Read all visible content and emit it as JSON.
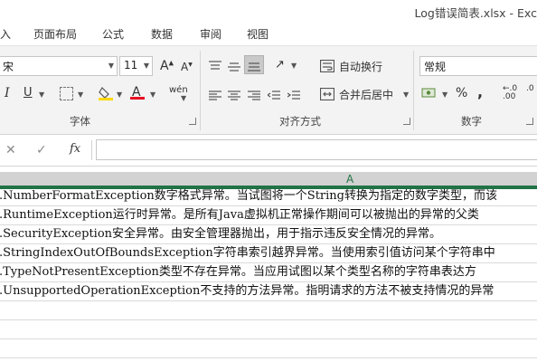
{
  "window": {
    "title": "Log错误简表.xlsx - Exc"
  },
  "tabs": [
    "入",
    "页面布局",
    "公式",
    "数据",
    "审阅",
    "视图"
  ],
  "ribbon": {
    "font": {
      "name": "宋",
      "size": "11",
      "group_label": "字体"
    },
    "alignment": {
      "wrap_text_label": "自动换行",
      "merge_center_label": "合并后居中",
      "group_label": "对齐方式"
    },
    "number": {
      "format": "常规",
      "percent_symbol": "%",
      "comma_symbol": ",",
      "group_label": "数字"
    }
  },
  "formula_bar": {
    "cancel_symbol": "✕",
    "enter_symbol": "✓",
    "fx_label": "fx",
    "value": ""
  },
  "columns": [
    "A"
  ],
  "rows": [
    ".NumberFormatException数字格式异常。当试图将一个String转换为指定的数字类型，而该",
    ".RuntimeException运行时异常。是所有Java虚拟机正常操作期间可以被抛出的异常的父类",
    ".SecurityException安全异常。由安全管理器抛出，用于指示违反安全情况的异常。",
    ".StringIndexOutOfBoundsException字符串索引越界异常。当使用索引值访问某个字符串中",
    ".TypeNotPresentException类型不存在异常。当应用试图以某个类型名称的字符串表达方",
    ".UnsupportedOperationException不支持的方法异常。指明请求的方法不被支持情况的异常"
  ],
  "colors": {
    "accent": "#217346",
    "font_color": "#e81123",
    "fill_color": "#ffd800"
  }
}
